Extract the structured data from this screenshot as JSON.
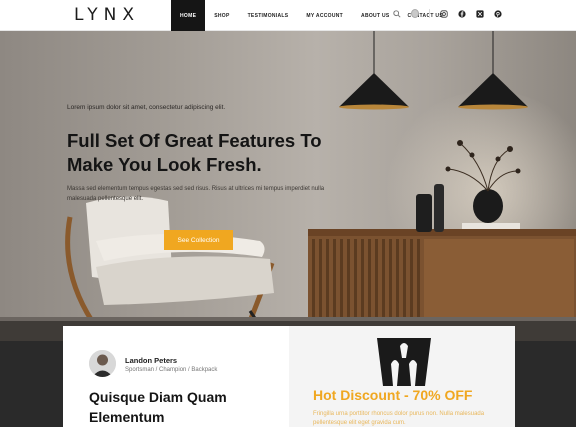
{
  "brand": {
    "logo": "LYNX"
  },
  "nav": {
    "items": [
      {
        "label": "HOME",
        "active": true
      },
      {
        "label": "SHOP",
        "active": false
      },
      {
        "label": "TESTIMONIALS",
        "active": false
      },
      {
        "label": "MY ACCOUNT",
        "active": false
      },
      {
        "label": "ABOUT US",
        "active": false
      },
      {
        "label": "CONTACT US",
        "active": false
      }
    ],
    "icons": [
      "search-icon",
      "user-icon",
      "instagram-icon",
      "facebook-icon",
      "x-twitter-icon",
      "pinterest-icon"
    ]
  },
  "hero": {
    "kicker": "Lorem ipsum dolor sit amet, consectetur adipiscing elit.",
    "title": "Full Set Of Great Features To Make You Look Fresh.",
    "description": "Massa sed elementum tempus egestas sed sed risus. Risus at ultrices mi tempus imperdiet nulla malesuada pellentesque elit.",
    "cta_label": "See Collection"
  },
  "testimonial": {
    "name": "Landon Peters",
    "role": "Sportsman / Champion / Backpack",
    "title": "Quisque Diam Quam Elementum"
  },
  "promo": {
    "title": "Hot Discount - 70% OFF",
    "description": "Fringilla urna porttitor rhoncus dolor purus non. Nulla malesuada pellentesque elit eget gravida cum."
  },
  "colors": {
    "accent": "#f0a720",
    "dark": "#151515",
    "nav_active_bg": "#151515"
  }
}
